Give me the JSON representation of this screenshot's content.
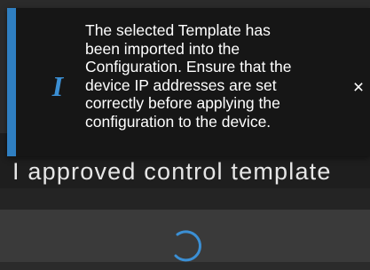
{
  "background": {
    "title_text": "I approved control template"
  },
  "toast": {
    "message": "The selected Template has\nbeen imported into the\nConfiguration. Ensure that the\ndevice IP addresses are set\ncorrectly before applying the\nconfiguration to the device.",
    "icon": "info-icon",
    "icon_glyph": "I",
    "close_glyph": "×",
    "accent_color": "#2f7fc1"
  },
  "loading": {
    "icon": "loading-spinner-icon"
  }
}
